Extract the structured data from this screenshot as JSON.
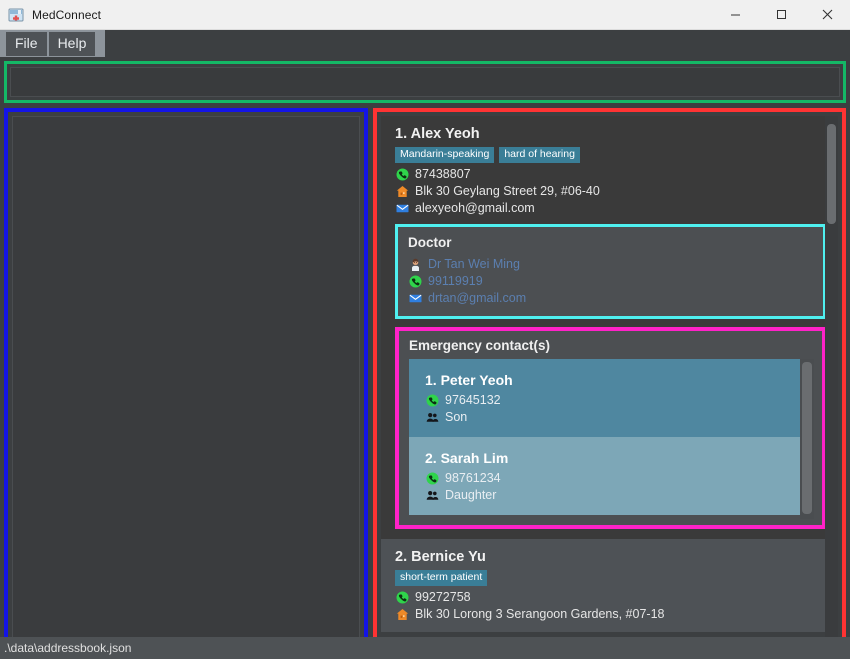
{
  "window": {
    "title": "MedConnect",
    "app_icon": "medkit-icon",
    "minimize_label": "Minimize",
    "maximize_label": "Maximize",
    "close_label": "Close"
  },
  "menubar": {
    "items": [
      {
        "label": "File",
        "name": "menu-file"
      },
      {
        "label": "Help",
        "name": "menu-help"
      }
    ]
  },
  "command_box": {
    "value": "",
    "placeholder": ""
  },
  "left_panel": {
    "content": ""
  },
  "sections": {
    "doctor_title": "Doctor",
    "emergency_title": "Emergency contact(s)"
  },
  "colors": {
    "command_border": "#14b866",
    "left_border": "#1414e6",
    "right_border": "#ff3333",
    "doctor_border": "#4ff0f0",
    "emergency_border": "#ff22c8",
    "tag_bg": "#3a7e97",
    "emergency_card_1": "#4f87a0",
    "emergency_card_2": "#7da7b7",
    "doctor_text": "#5b7fb0"
  },
  "persons": [
    {
      "index": "1.",
      "name": "Alex Yeoh",
      "tags": [
        "Mandarin-speaking",
        "hard of hearing"
      ],
      "phone": "87438807",
      "address": "Blk 30 Geylang Street 29, #06-40",
      "email": "alexyeoh@gmail.com",
      "doctor": {
        "name": "Dr Tan Wei Ming",
        "phone": "99119919",
        "email": "drtan@gmail.com"
      },
      "emergency_contacts": [
        {
          "index": "1.",
          "name": "Peter Yeoh",
          "phone": "97645132",
          "relationship": "Son"
        },
        {
          "index": "2.",
          "name": "Sarah Lim",
          "phone": "98761234",
          "relationship": "Daughter"
        }
      ]
    },
    {
      "index": "2.",
      "name": "Bernice Yu",
      "tags": [
        "short-term patient"
      ],
      "phone": "99272758",
      "address": "Blk 30 Lorong 3 Serangoon Gardens, #07-18",
      "email": "",
      "doctor": null,
      "emergency_contacts": []
    }
  ],
  "icons": {
    "phone": "phone-icon",
    "home": "home-icon",
    "email": "email-icon",
    "doctor": "doctor-icon",
    "relationship": "people-icon"
  },
  "statusbar": {
    "file_path": ".\\data\\addressbook.json"
  }
}
